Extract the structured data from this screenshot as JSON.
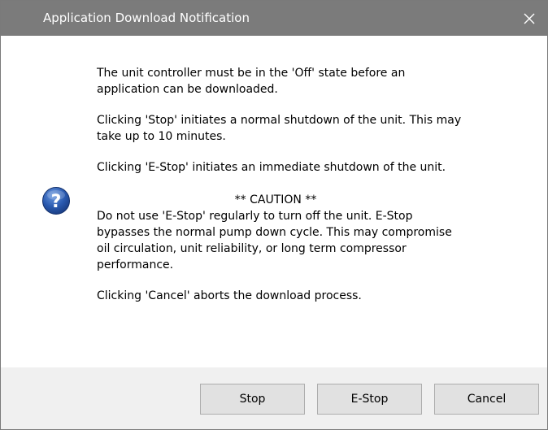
{
  "window": {
    "title": "Application Download Notification",
    "close_glyph": "✕"
  },
  "icon": {
    "name": "question-icon",
    "glyph": "?",
    "color": "#2a5ab0"
  },
  "message": {
    "para1_line1": "The unit controller must be in the 'Off' state before an",
    "para1_line2": "application can be downloaded.",
    "para2_line1": "Clicking 'Stop' initiates a normal shutdown of the unit. This may",
    "para2_line2": "take up to 10 minutes.",
    "para3": "Clicking 'E-Stop' initiates an immediate shutdown of the unit.",
    "caution_title": "** CAUTION **",
    "caution_line1": "Do not use 'E-Stop' regularly to turn off the unit.  E-Stop",
    "caution_line2": "bypasses the normal pump down cycle.  This may compromise",
    "caution_line3": "oil circulation, unit reliability, or long term compressor",
    "caution_line4": "performance.",
    "para5": "Clicking 'Cancel' aborts the download process."
  },
  "buttons": {
    "stop": "Stop",
    "estop": "E-Stop",
    "cancel": "Cancel"
  }
}
